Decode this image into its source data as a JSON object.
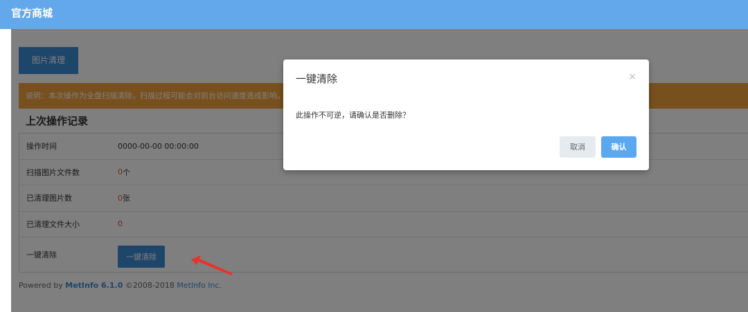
{
  "header": {
    "title": "官方商城"
  },
  "tab": {
    "label": "图片清理"
  },
  "notice": "说明：本次操作为全盘扫描清除，扫描过程可能会对前台访问速度造成影响，请在访问量较少时进行操作，清除后无法恢复，请谨慎操作以免造成文件丢失。",
  "section_title": "上次操作记录",
  "rows": [
    {
      "label": "操作时间",
      "value": "0000-00-00 00:00:00",
      "unit": ""
    },
    {
      "label": "扫描图片文件数",
      "value": "0",
      "unit": " 个"
    },
    {
      "label": "已清理图片数",
      "value": "0",
      "unit": " 张"
    },
    {
      "label": "已清理文件大小",
      "value": "0",
      "unit": ""
    },
    {
      "label": "一键清除",
      "button": "一键清除"
    }
  ],
  "footer": {
    "prefix": "Powered by ",
    "brand": "MetInfo 6.1.0",
    "copy": " ©2008-2018 ",
    "company": "MetInfo Inc."
  },
  "modal": {
    "title": "一键清除",
    "close": "×",
    "message": "此操作不可逆，请确认是否删除？",
    "cancel": "取消",
    "confirm": "确认"
  },
  "colors": {
    "header": "#62a8ea",
    "primary": "#3d8bd4",
    "notice": "#f0a13c",
    "confirm": "#5aa9f0",
    "arrow": "#e8332a"
  }
}
